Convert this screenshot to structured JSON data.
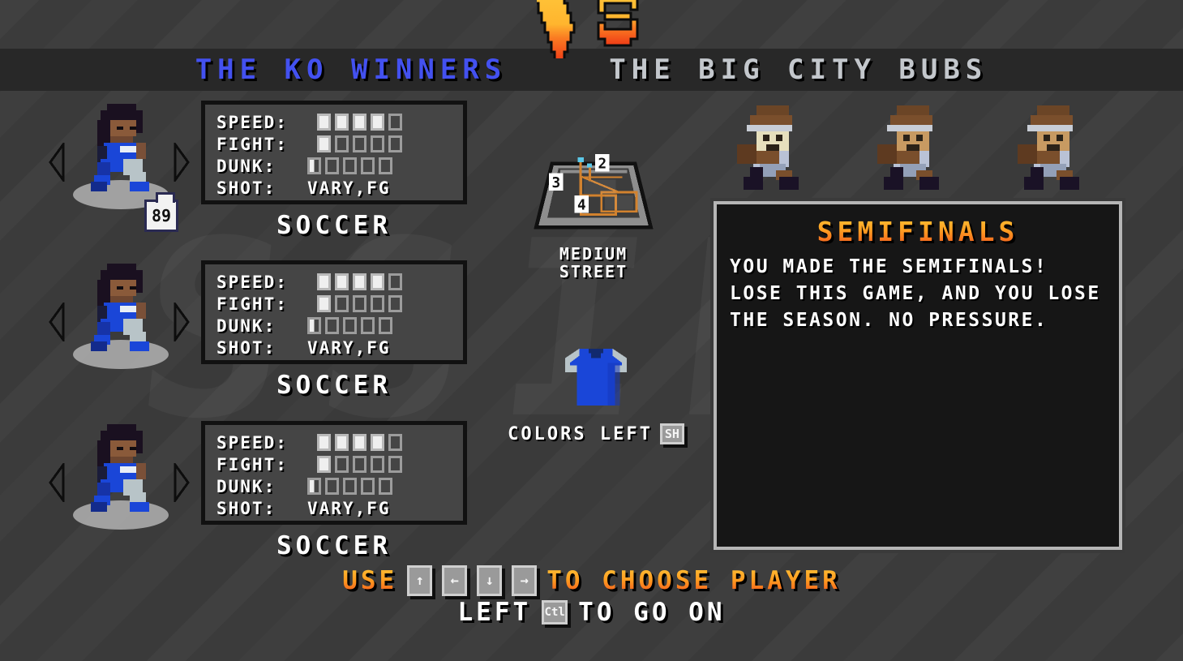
{
  "header": {
    "home_team": "THE KO WINNERS",
    "vs_label": "VS",
    "away_team": "THE BIG CITY BUBS",
    "home_color": "#4351f0",
    "away_color": "#c3c7cc"
  },
  "roster": {
    "stat_labels": {
      "speed": "SPEED:",
      "fight": "FIGHT:",
      "dunk": "DUNK:",
      "shot": "SHOT:"
    },
    "players": [
      {
        "name": "SOCCER",
        "jersey_number": "89",
        "speed": 4,
        "fight": 1,
        "dunk": 0.5,
        "shot": "VARY,FG",
        "pip_max": 5,
        "prev_label": "◀",
        "next_label": "▶"
      },
      {
        "name": "SOCCER",
        "jersey_number": "",
        "speed": 4,
        "fight": 1,
        "dunk": 0.5,
        "shot": "VARY,FG",
        "pip_max": 5,
        "prev_label": "◀",
        "next_label": "▶"
      },
      {
        "name": "SOCCER",
        "jersey_number": "",
        "speed": 4,
        "fight": 1,
        "dunk": 0.5,
        "shot": "VARY,FG",
        "pip_max": 5,
        "prev_label": "◀",
        "next_label": "▶"
      }
    ]
  },
  "court": {
    "name_line1": "MEDIUM",
    "name_line2": "STREET",
    "markers": [
      "3",
      "2",
      "4"
    ]
  },
  "jersey": {
    "colors_label": "COLORS LEFT",
    "key": "SH",
    "shirt_color": "#1a46d8",
    "sleeve_color": "#b8c4c8"
  },
  "info_panel": {
    "title": "SEMIFINALS",
    "lines": [
      "YOU MADE THE SEMIFINALS!",
      "LOSE THIS GAME, AND YOU LOSE",
      "THE SEASON. NO PRESSURE."
    ],
    "title_color": "#ffa022"
  },
  "hints": {
    "line1_pre": "USE",
    "line1_post": "TO CHOOSE PLAYER",
    "keys": [
      "↑",
      "←",
      "↓",
      "→"
    ],
    "key_names": [
      "up-arrow-key",
      "left-arrow-key",
      "down-arrow-key",
      "right-arrow-key"
    ],
    "line2_pre": "LEFT",
    "line2_key": "Ctl",
    "line2_post": "TO GO ON"
  },
  "opponents": {
    "count": 3,
    "sprite_name": "opponent-player-sprite"
  },
  "background": {
    "watermark_text": "SSIDE",
    "base_color": "#3b3b3b"
  }
}
